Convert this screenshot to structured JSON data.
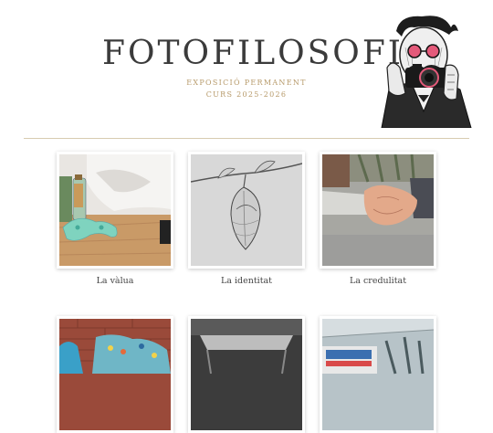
{
  "header": {
    "title": "FOTOFILOSOFIA",
    "subtitle_line1": "EXPOSICIÓ PERMANENT",
    "subtitle_line2": "CURS 2025-2026",
    "portrait_icon": "photographer-illustration-icon"
  },
  "gallery": {
    "items": [
      {
        "caption": "La vàlua"
      },
      {
        "caption": "La identitat"
      },
      {
        "caption": "La credulitat"
      }
    ]
  },
  "colors": {
    "title": "#3b3b3b",
    "accent": "#b79a6a",
    "divider": "#d8cbb0"
  }
}
